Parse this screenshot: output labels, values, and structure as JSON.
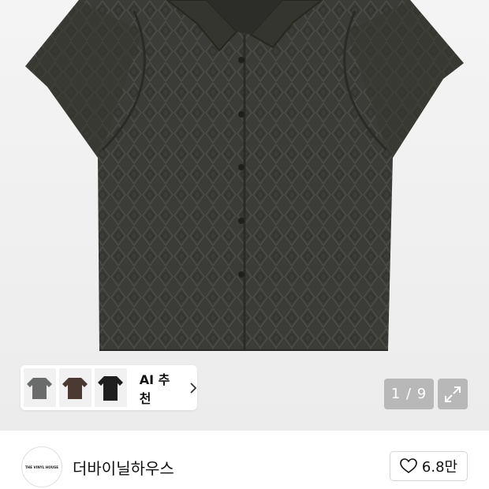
{
  "product_image": {
    "alt": "",
    "counter": "1 / 9"
  },
  "ai_recommend": {
    "label": "AI 추천",
    "thumbnails": [
      {
        "icon": "shirt-thumb-gray",
        "color": "#6a6c6c"
      },
      {
        "icon": "shirt-thumb-brown",
        "color": "#4a3a32"
      },
      {
        "icon": "shirt-thumb-black",
        "color": "#1e1e1e"
      }
    ]
  },
  "brand": {
    "logo_text": "THE VINYL HOUSE",
    "name": "더바이닐하우스"
  },
  "like": {
    "icon": "heart-icon",
    "count": "6.8만"
  },
  "colors": {
    "shirt": "#3a3b36",
    "overlay": "#8c8c8c"
  }
}
